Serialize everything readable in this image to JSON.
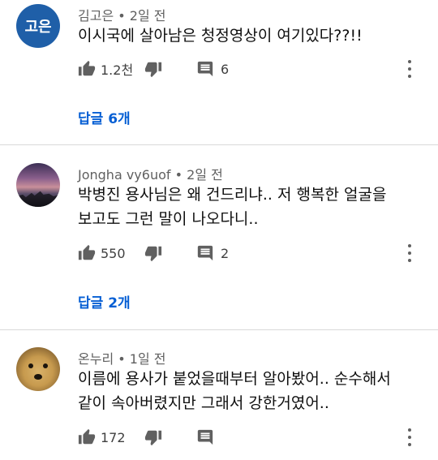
{
  "comments": [
    {
      "avatar_text": "고은",
      "author": "김고은",
      "time": "2일 전",
      "lines": [
        "이시국에 살아남은 청정영상이 여기있다??!!"
      ],
      "likes": "1.2천",
      "reply_count": "6",
      "replies_label": "답글 6개"
    },
    {
      "author": "Jongha vy6uof",
      "time": "2일 전",
      "lines": [
        "박병진 용사님은 왜 건드리냐.. 저 행복한 얼굴을",
        "보고도 그런 말이 나오다니.."
      ],
      "likes": "550",
      "reply_count": "2",
      "replies_label": "답글 2개"
    },
    {
      "author": "온누리",
      "time": "1일 전",
      "lines": [
        "이름에 용사가 붙었을때부터 알아봤어.. 순수해서",
        "같이 속아버렸지만 그래서 강한거였어.."
      ],
      "likes": "172"
    }
  ],
  "colors": {
    "link": "#065fd4",
    "meta": "#606060",
    "avatar": "#1f5fa8"
  }
}
